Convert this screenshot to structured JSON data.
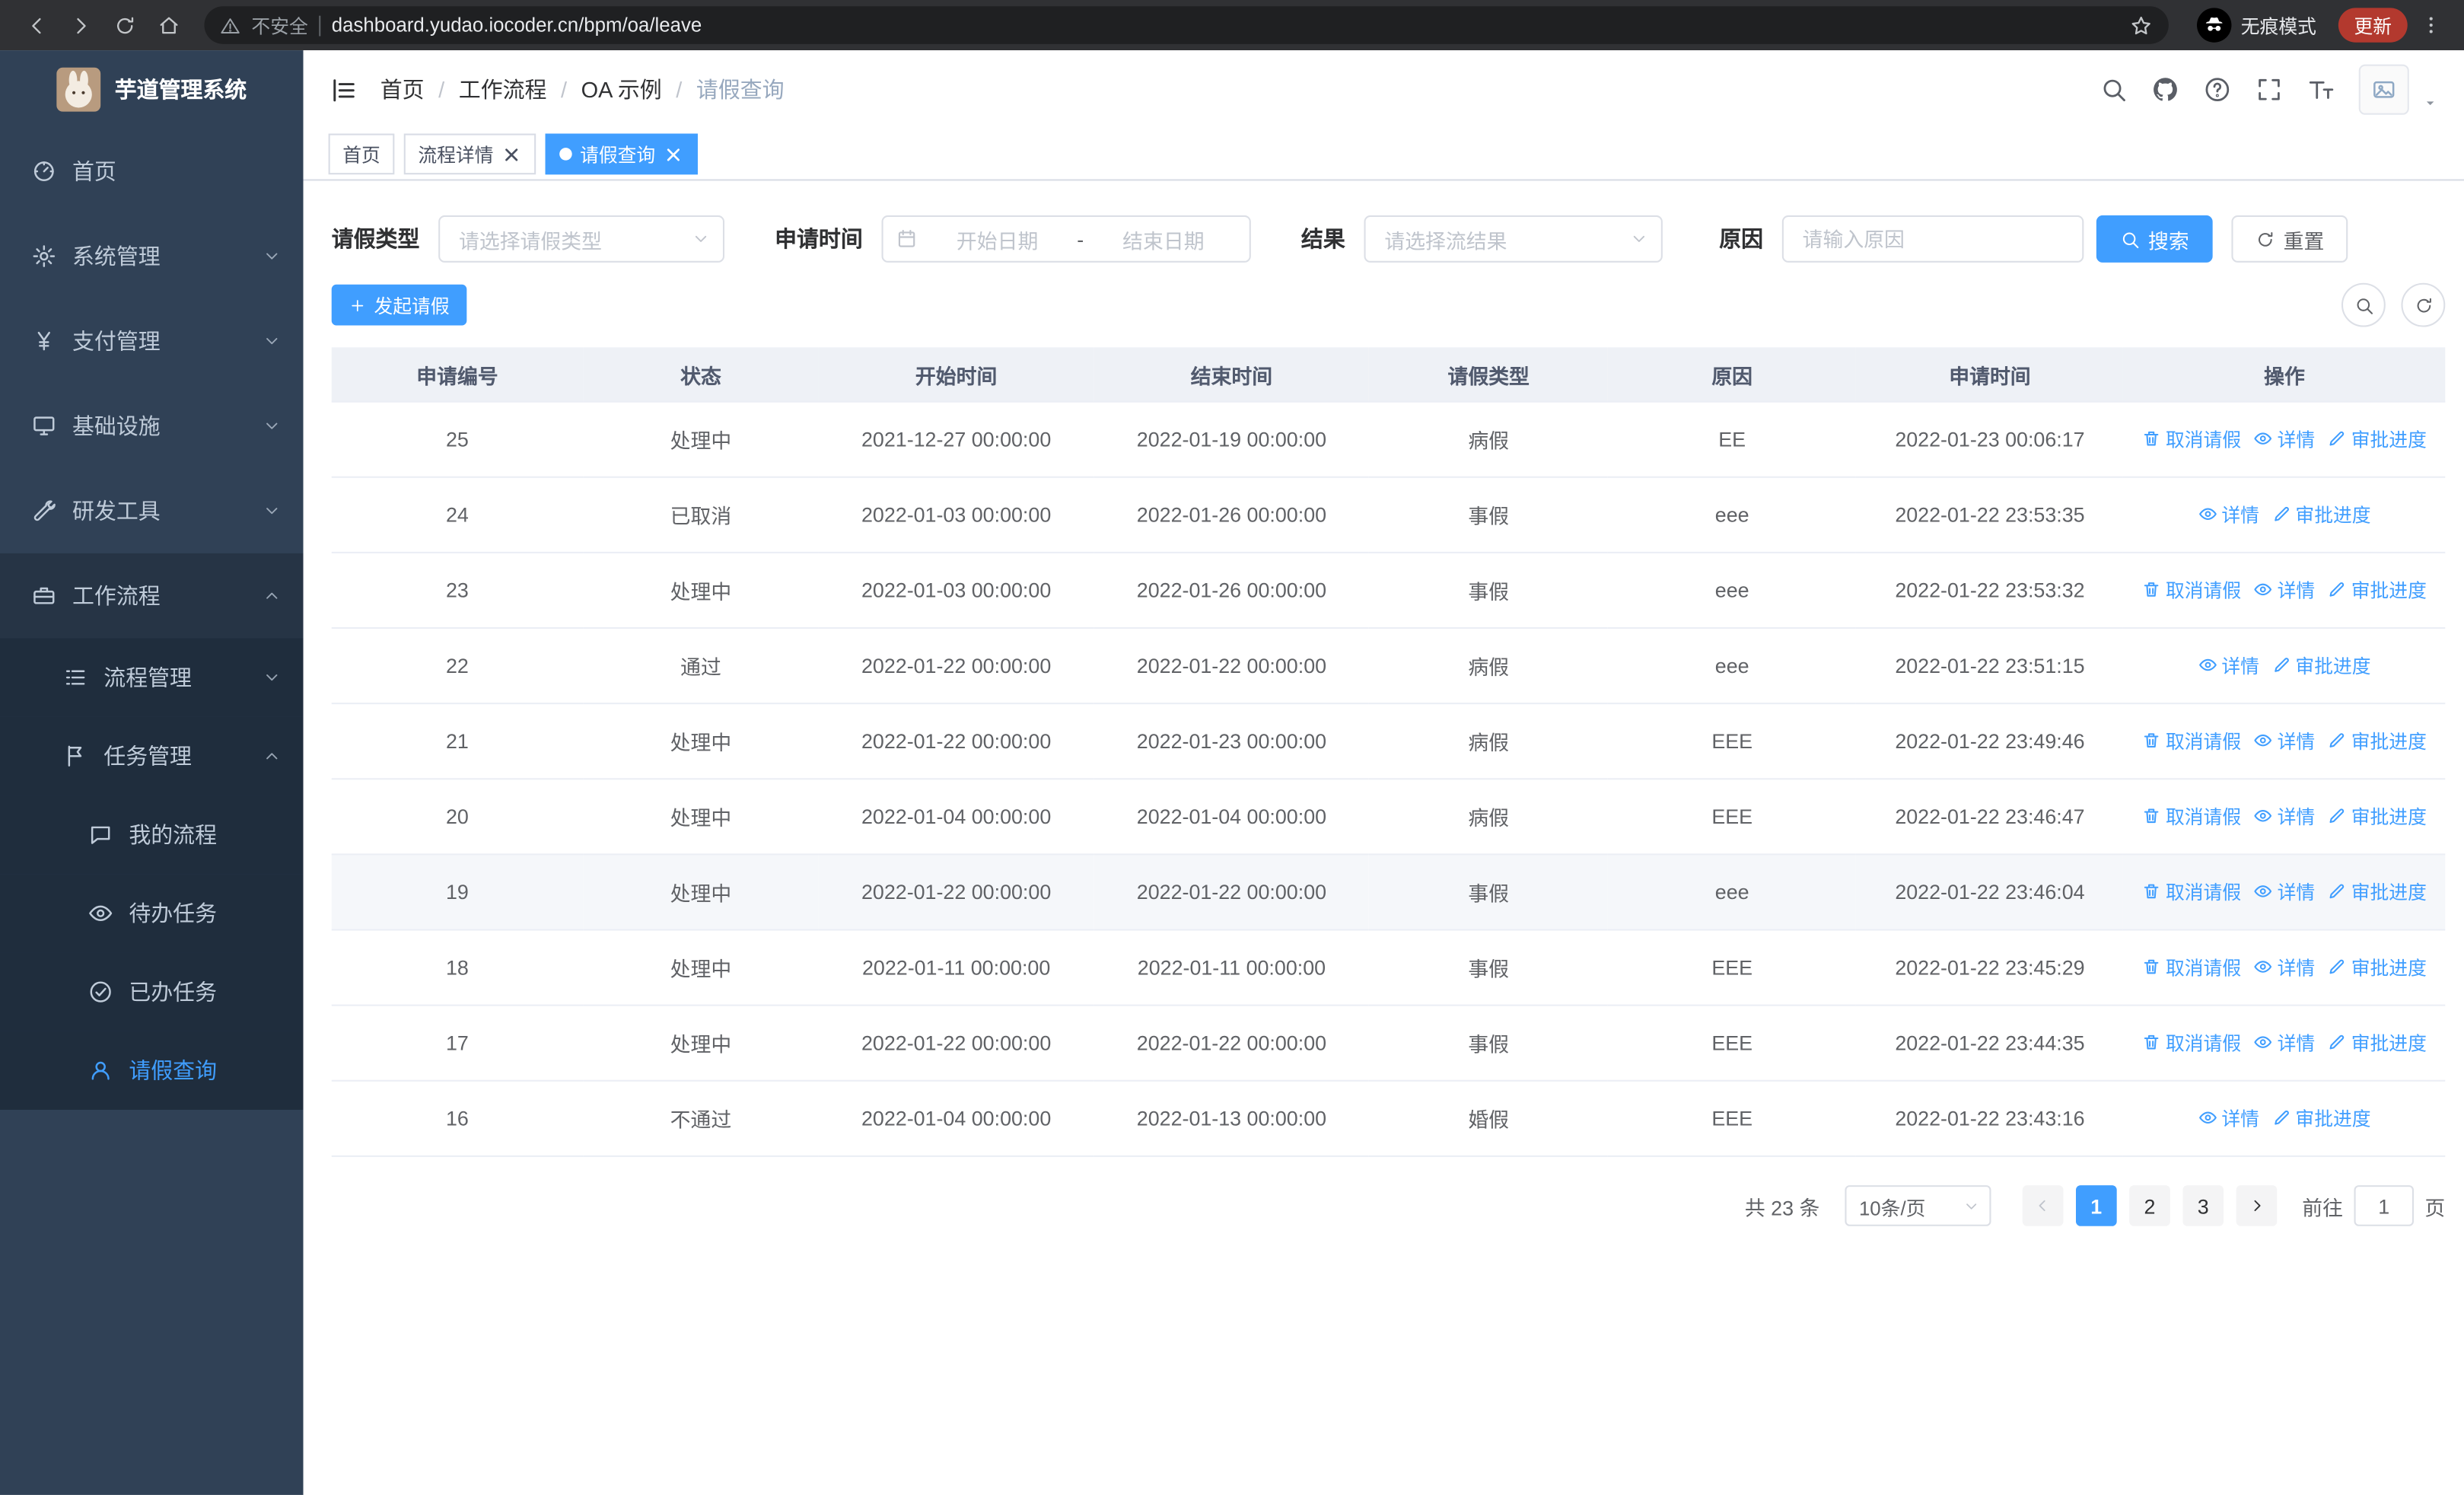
{
  "browser": {
    "security_label": "不安全",
    "url": "dashboard.yudao.iocoder.cn/bpm/oa/leave",
    "incognito_label": "无痕模式",
    "update_label": "更新"
  },
  "sidebar": {
    "logo_title": "芋道管理系统",
    "items": [
      {
        "key": "home",
        "label": "首页",
        "icon": "dashboard-icon",
        "level": 0
      },
      {
        "key": "system",
        "label": "系统管理",
        "icon": "gear-icon",
        "level": 0,
        "chevron": "down"
      },
      {
        "key": "payment",
        "label": "支付管理",
        "icon": "yen-icon",
        "level": 0,
        "chevron": "down"
      },
      {
        "key": "infrastructure",
        "label": "基础设施",
        "icon": "monitor-icon",
        "level": 0,
        "chevron": "down"
      },
      {
        "key": "devtools",
        "label": "研发工具",
        "icon": "tool-icon",
        "level": 0,
        "chevron": "down"
      },
      {
        "key": "workflow",
        "label": "工作流程",
        "icon": "briefcase-icon",
        "level": 0,
        "chevron": "up",
        "expanded": true
      },
      {
        "key": "process-management",
        "label": "流程管理",
        "icon": "list-icon",
        "level": 1,
        "chevron": "down",
        "group": true
      },
      {
        "key": "task-management",
        "label": "任务管理",
        "icon": "flag-icon",
        "level": 1,
        "chevron": "up",
        "group": true
      },
      {
        "key": "my-process",
        "label": "我的流程",
        "icon": "chat-icon",
        "level": 2,
        "group": true
      },
      {
        "key": "todo-tasks",
        "label": "待办任务",
        "icon": "eye-icon",
        "level": 2,
        "group": true
      },
      {
        "key": "done-tasks",
        "label": "已办任务",
        "icon": "check-icon",
        "level": 2,
        "group": true
      },
      {
        "key": "leave-query",
        "label": "请假查询",
        "icon": "user-icon",
        "level": 2,
        "group": true,
        "active": true
      }
    ]
  },
  "header": {
    "breadcrumb": [
      "首页",
      "工作流程",
      "OA 示例",
      "请假查询"
    ],
    "breadcrumb_separator": "/"
  },
  "tabs": [
    {
      "key": "home",
      "label": "首页",
      "closable": false,
      "active": false
    },
    {
      "key": "process-detail",
      "label": "流程详情",
      "closable": true,
      "active": false
    },
    {
      "key": "leave-query",
      "label": "请假查询",
      "closable": true,
      "active": true
    }
  ],
  "filters": {
    "type_label": "请假类型",
    "type_placeholder": "请选择请假类型",
    "time_label": "申请时间",
    "start_placeholder": "开始日期",
    "separator": "-",
    "end_placeholder": "结束日期",
    "result_label": "结果",
    "result_placeholder": "请选择流结果",
    "reason_label": "原因",
    "reason_placeholder": "请输入原因",
    "search_label": "搜索",
    "reset_label": "重置"
  },
  "toolbar": {
    "create_label": "发起请假"
  },
  "table": {
    "columns": [
      "申请编号",
      "状态",
      "开始时间",
      "结束时间",
      "请假类型",
      "原因",
      "申请时间",
      "操作"
    ],
    "action_labels": {
      "cancel": "取消请假",
      "detail": "详情",
      "progress": "审批进度"
    },
    "rows": [
      {
        "id": "25",
        "status": "处理中",
        "start": "2021-12-27 00:00:00",
        "end": "2022-01-19 00:00:00",
        "type": "病假",
        "reason": "EE",
        "applyTime": "2022-01-23 00:06:17",
        "actions": [
          "cancel",
          "detail",
          "progress"
        ]
      },
      {
        "id": "24",
        "status": "已取消",
        "start": "2022-01-03 00:00:00",
        "end": "2022-01-26 00:00:00",
        "type": "事假",
        "reason": "eee",
        "applyTime": "2022-01-22 23:53:35",
        "actions": [
          "detail",
          "progress"
        ]
      },
      {
        "id": "23",
        "status": "处理中",
        "start": "2022-01-03 00:00:00",
        "end": "2022-01-26 00:00:00",
        "type": "事假",
        "reason": "eee",
        "applyTime": "2022-01-22 23:53:32",
        "actions": [
          "cancel",
          "detail",
          "progress"
        ]
      },
      {
        "id": "22",
        "status": "通过",
        "start": "2022-01-22 00:00:00",
        "end": "2022-01-22 00:00:00",
        "type": "病假",
        "reason": "eee",
        "applyTime": "2022-01-22 23:51:15",
        "actions": [
          "detail",
          "progress"
        ]
      },
      {
        "id": "21",
        "status": "处理中",
        "start": "2022-01-22 00:00:00",
        "end": "2022-01-23 00:00:00",
        "type": "病假",
        "reason": "EEE",
        "applyTime": "2022-01-22 23:49:46",
        "actions": [
          "cancel",
          "detail",
          "progress"
        ]
      },
      {
        "id": "20",
        "status": "处理中",
        "start": "2022-01-04 00:00:00",
        "end": "2022-01-04 00:00:00",
        "type": "病假",
        "reason": "EEE",
        "applyTime": "2022-01-22 23:46:47",
        "actions": [
          "cancel",
          "detail",
          "progress"
        ]
      },
      {
        "id": "19",
        "status": "处理中",
        "start": "2022-01-22 00:00:00",
        "end": "2022-01-22 00:00:00",
        "type": "事假",
        "reason": "eee",
        "applyTime": "2022-01-22 23:46:04",
        "actions": [
          "cancel",
          "detail",
          "progress"
        ],
        "highlighted": true
      },
      {
        "id": "18",
        "status": "处理中",
        "start": "2022-01-11 00:00:00",
        "end": "2022-01-11 00:00:00",
        "type": "事假",
        "reason": "EEE",
        "applyTime": "2022-01-22 23:45:29",
        "actions": [
          "cancel",
          "detail",
          "progress"
        ]
      },
      {
        "id": "17",
        "status": "处理中",
        "start": "2022-01-22 00:00:00",
        "end": "2022-01-22 00:00:00",
        "type": "事假",
        "reason": "EEE",
        "applyTime": "2022-01-22 23:44:35",
        "actions": [
          "cancel",
          "detail",
          "progress"
        ]
      },
      {
        "id": "16",
        "status": "不通过",
        "start": "2022-01-04 00:00:00",
        "end": "2022-01-13 00:00:00",
        "type": "婚假",
        "reason": "EEE",
        "applyTime": "2022-01-22 23:43:16",
        "actions": [
          "detail",
          "progress"
        ]
      }
    ]
  },
  "pagination": {
    "total_label": "共 23 条",
    "page_size": "10条/页",
    "pages": [
      "1",
      "2",
      "3"
    ],
    "current_page": "1",
    "goto_label": "前往",
    "goto_value": "1",
    "unit_label": "页"
  },
  "colors": {
    "accent": "#409eff",
    "sidebar_bg": "#304156",
    "submenu_bg": "#1f2d3d",
    "table_header_bg": "#eef1f6"
  }
}
